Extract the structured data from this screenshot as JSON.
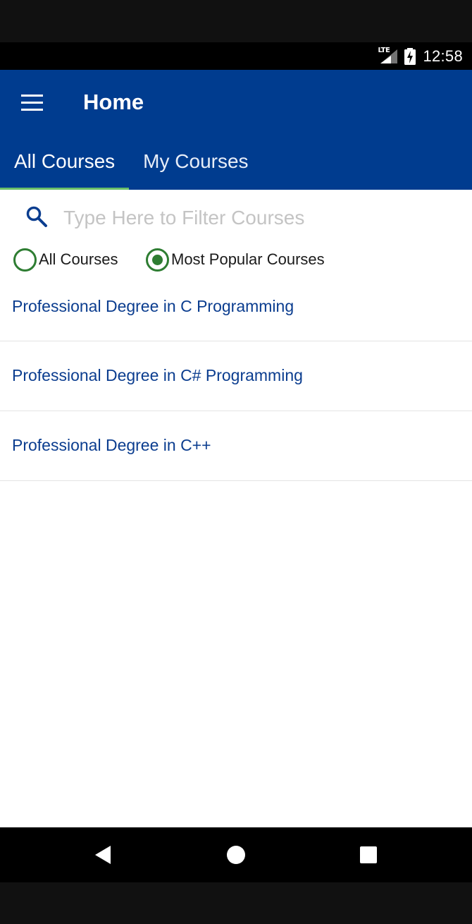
{
  "status_bar": {
    "network_label": "LTE",
    "time": "12:58",
    "icons": [
      "lte-signal-icon",
      "battery-charging-icon"
    ]
  },
  "app_bar": {
    "menu_icon": "hamburger-menu-icon",
    "title": "Home",
    "background_color": "#003c8f"
  },
  "tabs": [
    {
      "label": "All Courses",
      "selected": true
    },
    {
      "label": "My Courses",
      "selected": false
    }
  ],
  "tab_indicator_color": "#6abf69",
  "search": {
    "icon": "search-icon",
    "placeholder": "Type Here to Filter Courses",
    "value": ""
  },
  "filter": {
    "options": [
      {
        "label": "All Courses",
        "checked": false
      },
      {
        "label": "Most Popular Courses",
        "checked": true
      }
    ],
    "accent_color": "#2e7d32"
  },
  "courses": [
    {
      "label": "Professional Degree in C Programming"
    },
    {
      "label": "Professional Degree in C# Programming"
    },
    {
      "label": "Professional Degree in C++"
    }
  ],
  "course_text_color": "#0b3d8f",
  "nav_bar": {
    "icons": [
      "back-triangle-icon",
      "home-circle-icon",
      "recents-square-icon"
    ]
  }
}
